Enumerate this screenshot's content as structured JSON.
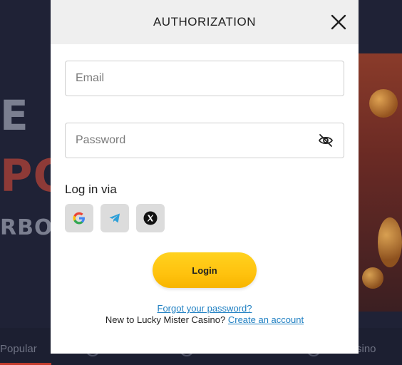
{
  "background": {
    "letters": [
      "E",
      "PO",
      "RBOA"
    ],
    "tabs": [
      "Popular",
      "sino"
    ]
  },
  "modal": {
    "title": "AUTHORIZATION",
    "email_placeholder": "Email",
    "password_placeholder": "Password",
    "login_via_label": "Log in via",
    "social_providers": [
      "google-icon",
      "telegram-icon",
      "x-icon"
    ],
    "login_label": "Login",
    "forgot_label": "Forgot your password?",
    "signup_prefix": "New to Lucky Mister Casino?",
    "signup_link": "Create an account"
  },
  "colors": {
    "accent_yellow": "#ffc20e",
    "link_blue": "#1e7fc2",
    "backdrop": "#1f2236"
  }
}
